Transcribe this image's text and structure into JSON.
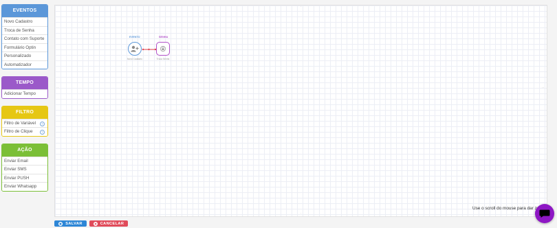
{
  "sidebar": {
    "eventos": {
      "title": "EVENTOS",
      "items": [
        "Novo Cadastro",
        "Troca de Senha",
        "Contato com Suporte",
        "Formulário Optin",
        "Personalizado",
        "Automatizador"
      ]
    },
    "tempo": {
      "title": "TEMPO",
      "items": [
        "Adicionar Tempo"
      ]
    },
    "filtro": {
      "title": "FILTRO",
      "items": [
        "Filtro de Variável",
        "Filtro de Clique"
      ],
      "help_glyph": "?"
    },
    "acao": {
      "title": "AÇÃO",
      "items": [
        "Enviar Email",
        "Enviar SMS",
        "Enviar PUSH",
        "Enviar Whatsapp"
      ]
    }
  },
  "canvas": {
    "nodes": [
      {
        "tag": "EVENTO",
        "label": "Novo Cadastro",
        "color": "#5b97d9",
        "icon": "user-plus-icon"
      },
      {
        "tag": "SENHA",
        "label": "Troca Senha",
        "color": "#b04fc7",
        "icon": "lock-icon"
      }
    ],
    "connector_color": "#e2444f",
    "hint": "Use o scroll do mouse para dar zo..."
  },
  "footer": {
    "save_label": "SALVAR",
    "cancel_label": "CANCELAR"
  },
  "colors": {
    "eventos": "#5b97d9",
    "tempo": "#9b59c9",
    "filtro": "#e6c713",
    "acao": "#7bbf37",
    "save": "#2d86d6",
    "cancel": "#e04b5a",
    "chat": "#8e17c4"
  }
}
